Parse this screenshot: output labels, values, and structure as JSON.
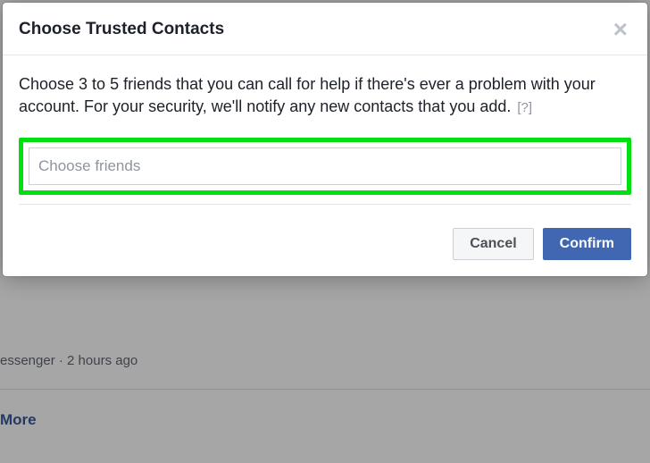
{
  "modal": {
    "title": "Choose Trusted Contacts",
    "body_text": "Choose 3 to 5 friends that you can call for help if there's ever a problem with your account. For your security, we'll notify any new contacts that you add.",
    "help_marker": "[?]",
    "input_placeholder": "Choose friends",
    "cancel_label": "Cancel",
    "confirm_label": "Confirm"
  },
  "background": {
    "messenger_line": "essenger · 2 hours ago",
    "more_link": "More"
  },
  "colors": {
    "highlight_border": "#00e010",
    "primary_button": "#4267b2"
  }
}
